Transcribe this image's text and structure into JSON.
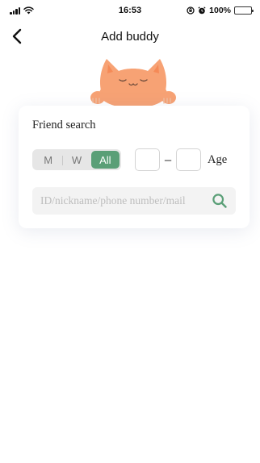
{
  "status_bar": {
    "time": "16:53",
    "battery_text": "100%",
    "icons": [
      "signal-icon",
      "wifi-icon",
      "orientation-lock-icon",
      "alarm-icon",
      "battery-charging-icon"
    ]
  },
  "nav": {
    "title": "Add buddy",
    "back_icon": "chevron-left-icon"
  },
  "mascot": {
    "icon": "cat-mascot-icon",
    "color": "#f7a274"
  },
  "search_card": {
    "title": "Friend search",
    "gender_options": [
      {
        "label": "M",
        "selected": false
      },
      {
        "label": "W",
        "selected": false
      },
      {
        "label": "All",
        "selected": true
      }
    ],
    "age": {
      "min_value": "",
      "max_value": "",
      "separator": "–",
      "label": "Age"
    },
    "search": {
      "placeholder": "ID/nickname/phone number/mail",
      "value": "",
      "icon": "search-icon"
    }
  },
  "colors": {
    "accent": "#5a9f77",
    "segment_bg": "#e6e6e6",
    "input_bg": "#f3f3f3"
  }
}
